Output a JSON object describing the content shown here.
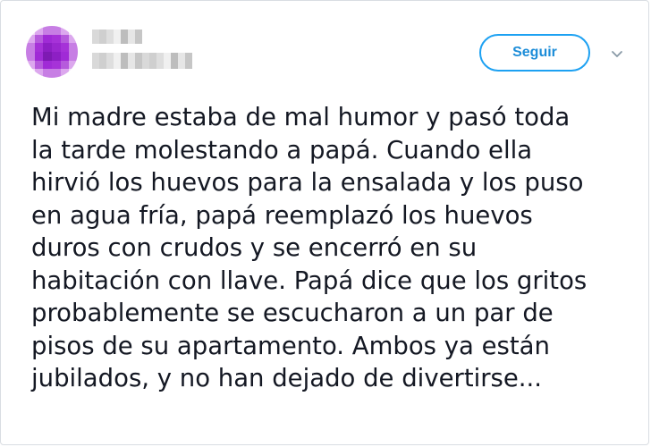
{
  "tweet": {
    "author_name_redacted": "",
    "author_handle_redacted": "",
    "follow_label": "Seguir",
    "more_icon": "chevron-down-icon",
    "lines": [
      "Mi madre estaba de mal humor y pasó toda",
      "la tarde molestando a papá. Cuando ella",
      "hirvió los huevos para la ensalada y los puso",
      "en agua fría, papá reemplazó los huevos",
      "duros con crudos y se encerró en su",
      "habitación con llave. Papá dice que los gritos",
      "probablemente se escucharon a un par de",
      "pisos de su apartamento. Ambos ya están",
      "jubilados, y no han dejado de divertirse..."
    ]
  },
  "colors": {
    "accent": "#1da1f2",
    "avatar_main": "#a02bd6",
    "text": "#141823"
  }
}
